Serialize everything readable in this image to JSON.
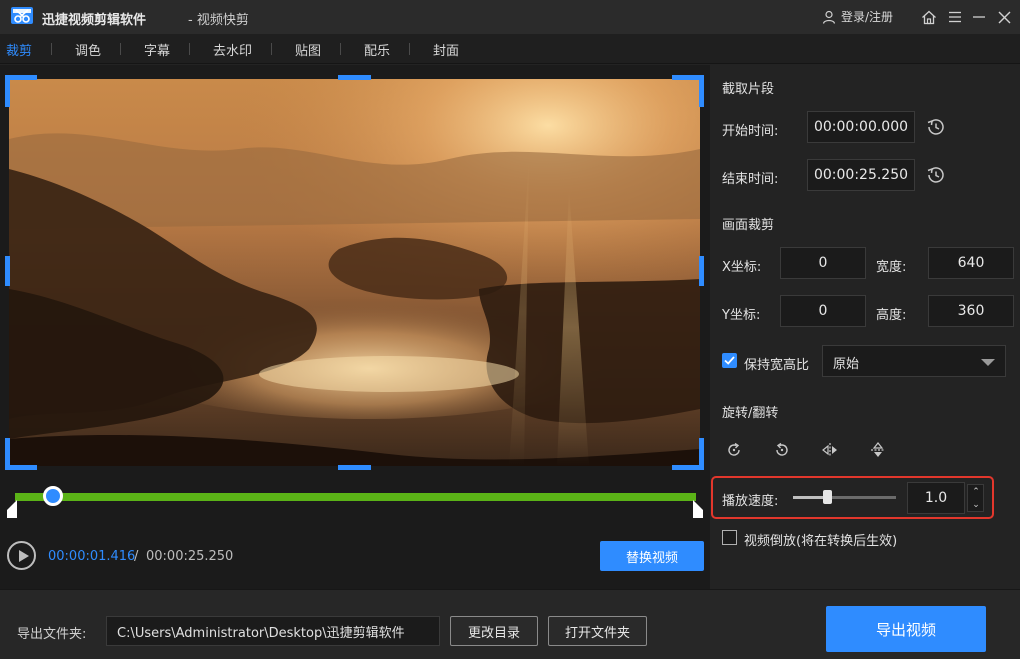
{
  "app": {
    "title": "迅捷视频剪辑软件",
    "subtitle": "- 视频快剪",
    "login_label": "登录/注册",
    "icons": [
      "app-logo-icon",
      "user-icon",
      "home-icon",
      "menu-icon",
      "minimize-icon",
      "close-icon"
    ]
  },
  "tabs": [
    {
      "label": "裁剪",
      "active": true
    },
    {
      "label": "调色",
      "active": false
    },
    {
      "label": "字幕",
      "active": false
    },
    {
      "label": "去水印",
      "active": false
    },
    {
      "label": "贴图",
      "active": false
    },
    {
      "label": "配乐",
      "active": false
    },
    {
      "label": "封面",
      "active": false
    }
  ],
  "player": {
    "current_time": "00:00:01.416",
    "separator": "/",
    "total_time": "00:00:25.250",
    "replace_button": "替换视频",
    "progress_fraction": 0.056
  },
  "clip": {
    "section_title": "截取片段",
    "start_label": "开始时间:",
    "start_value": "00:00:00.000",
    "end_label": "结束时间:",
    "end_value": "00:00:25.250"
  },
  "crop": {
    "section_title": "画面裁剪",
    "x_label": "X坐标:",
    "x_value": "0",
    "width_label": "宽度:",
    "width_value": "640",
    "y_label": "Y坐标:",
    "y_value": "0",
    "height_label": "高度:",
    "height_value": "360",
    "keep_ratio_label": "保持宽高比",
    "keep_ratio_checked": true,
    "ratio_selected": "原始"
  },
  "rotate": {
    "section_title": "旋转/翻转",
    "icons": [
      "rotate-clockwise-icon",
      "rotate-counterclockwise-icon",
      "flip-horizontal-icon",
      "flip-vertical-icon"
    ]
  },
  "speed": {
    "label": "播放速度:",
    "value": "1.0",
    "slider_fraction": 0.33
  },
  "reverse": {
    "label": "视频倒放(将在转换后生效)",
    "checked": false
  },
  "output": {
    "label": "导出文件夹:",
    "path": "C:\\Users\\Administrator\\Desktop\\迅捷剪辑软件",
    "change_dir_button": "更改目录",
    "open_folder_button": "打开文件夹",
    "export_button": "导出视频"
  },
  "colors": {
    "accent": "#2f8cff",
    "timeline": "#5bb317",
    "highlight": "#e2372c"
  }
}
